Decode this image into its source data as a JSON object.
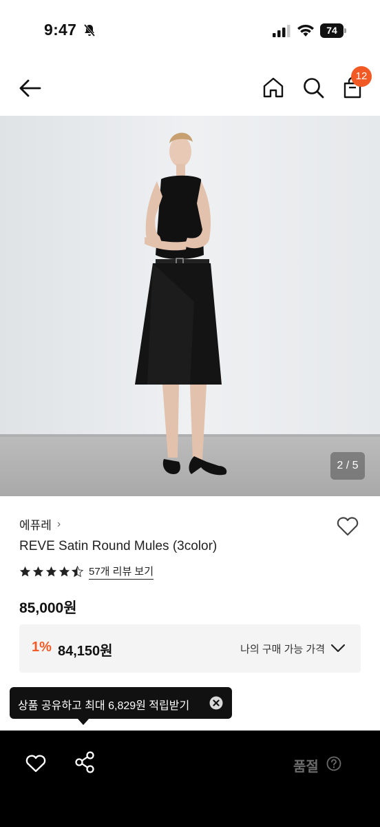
{
  "status_bar": {
    "time": "9:47",
    "battery": "74"
  },
  "header": {
    "cart_count": "12"
  },
  "gallery": {
    "counter": "2 / 5"
  },
  "product": {
    "brand": "에퓨레",
    "brand_chevron": "›",
    "name": "REVE Satin Round Mules (3color)",
    "rating": 4.5,
    "review_link": "57개 리뷰 보기",
    "price": "85,000원"
  },
  "discount": {
    "rate": "1%",
    "price": "84,150원",
    "label": "나의 구매 가능 가격"
  },
  "tooltip": {
    "text": "상품 공유하고 최대 6,829원 적립받기"
  },
  "bottom_bar": {
    "status": "품절"
  },
  "colors": {
    "accent": "#f15a24",
    "bar": "#000000",
    "soldout": "#6b6b6b"
  }
}
